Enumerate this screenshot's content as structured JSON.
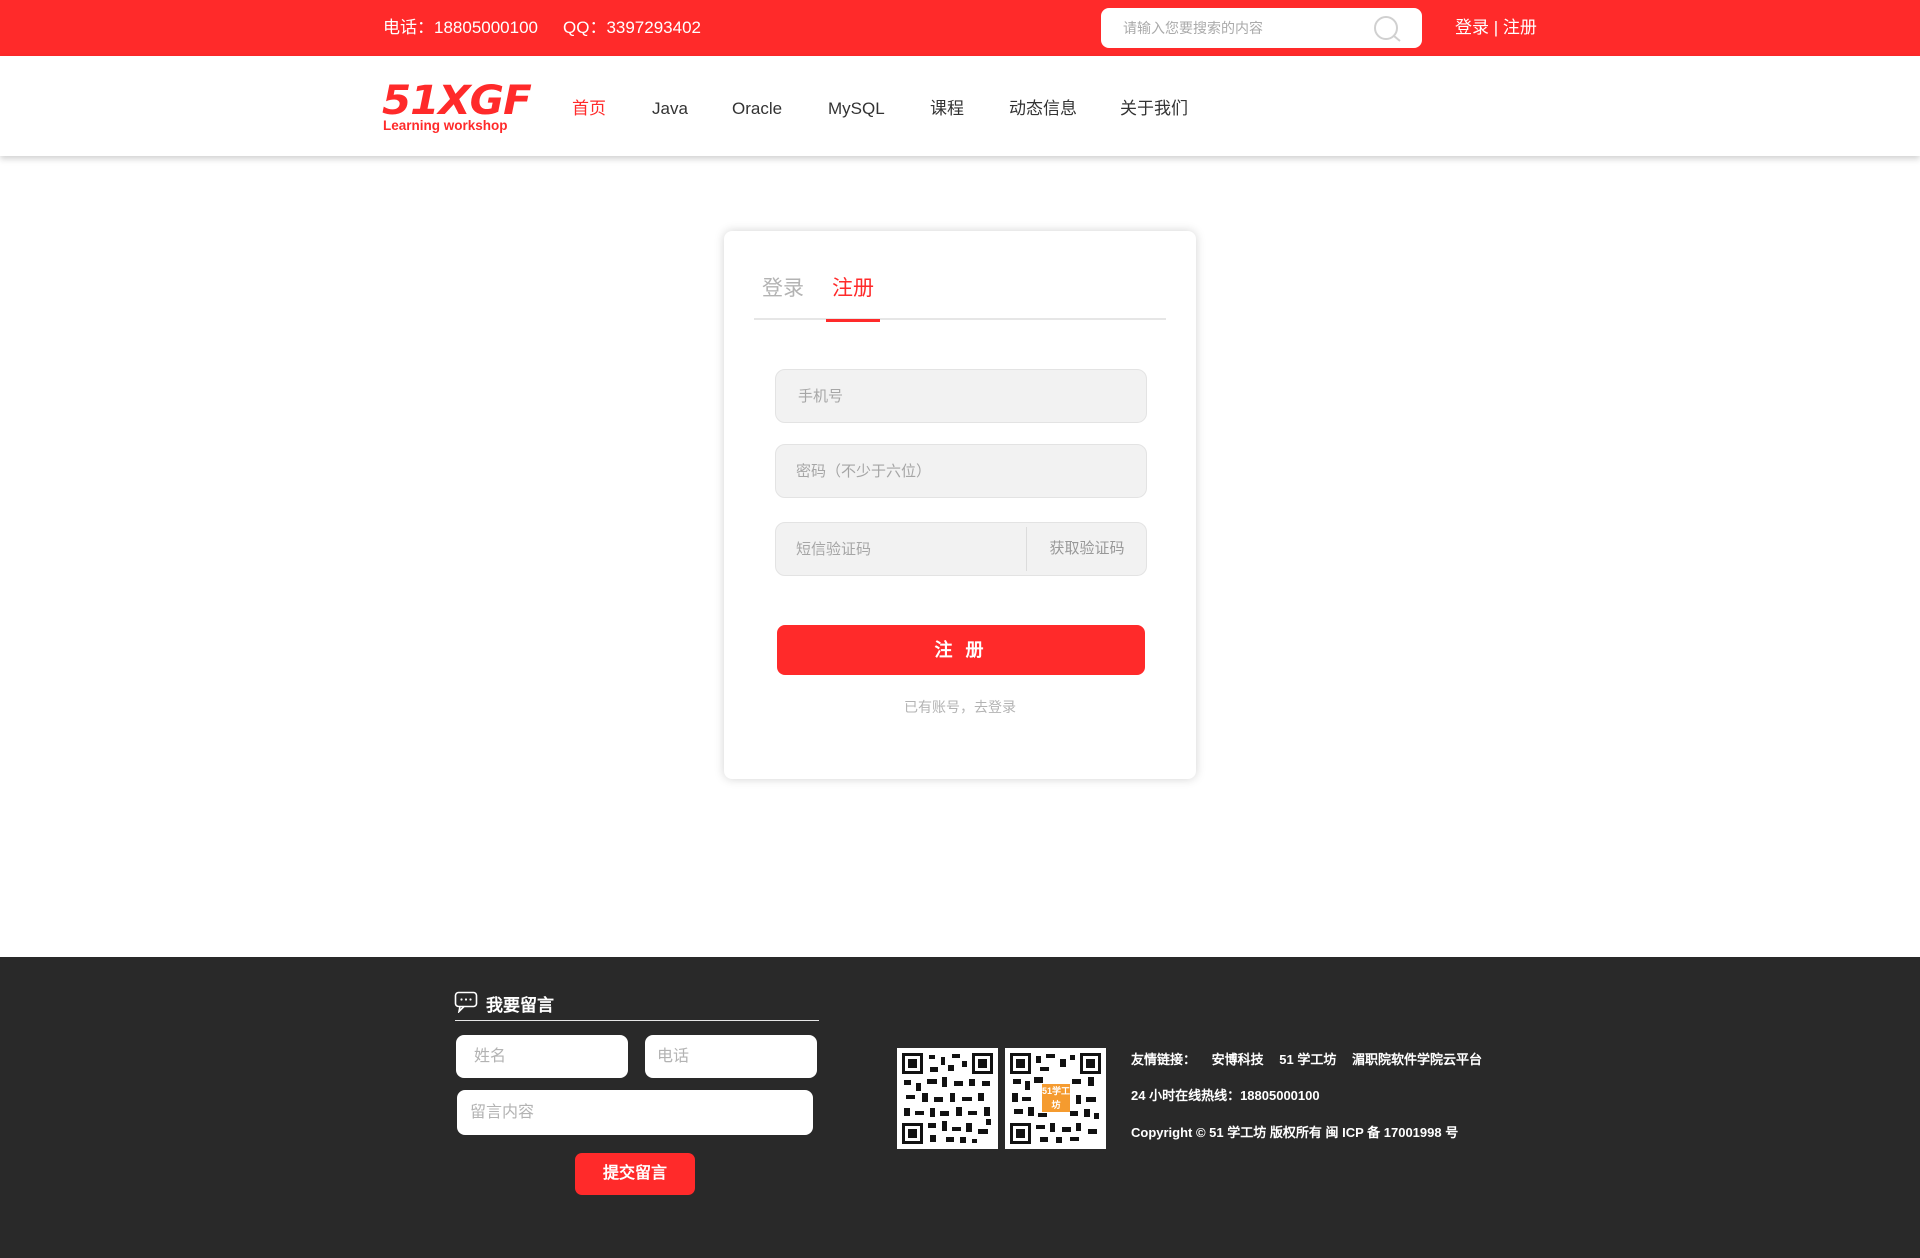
{
  "topbar": {
    "phone": "电话：18805000100",
    "qq": "QQ：3397293402",
    "search_placeholder": "请输入您要搜索的内容",
    "login": "登录",
    "separator": "|",
    "register": "注册"
  },
  "logo": {
    "main": "51XGF",
    "sub": "Learning workshop"
  },
  "nav": {
    "items": [
      {
        "label": "首页",
        "active": true
      },
      {
        "label": "Java",
        "active": false
      },
      {
        "label": "Oracle",
        "active": false
      },
      {
        "label": "MySQL",
        "active": false
      },
      {
        "label": "课程",
        "active": false
      },
      {
        "label": "动态信息",
        "active": false
      },
      {
        "label": "关于我们",
        "active": false
      }
    ]
  },
  "card": {
    "tab_login": "登录",
    "tab_register": "注册",
    "phone_placeholder": "手机号",
    "password_placeholder": "密码（不少于六位）",
    "sms_placeholder": "短信验证码",
    "get_code": "获取验证码",
    "submit": "注 册",
    "to_login": "已有账号，去登录"
  },
  "footer": {
    "message_title": "我要留言",
    "name_placeholder": "姓名",
    "tel_placeholder": "电话",
    "content_placeholder": "留言内容",
    "submit": "提交留言",
    "qr_badge": "51学工坊",
    "links_label": "友情链接：",
    "links": [
      "安博科技",
      "51 学工坊",
      "湄职院软件学院云平台"
    ],
    "hotline": "24 小时在线热线：18805000100",
    "copyright": "Copyright © 51 学工坊 版权所有 闽 ICP 备 17001998 号"
  },
  "colors": {
    "brand_red": "#ff2a2a",
    "footer_bg": "#292929"
  }
}
